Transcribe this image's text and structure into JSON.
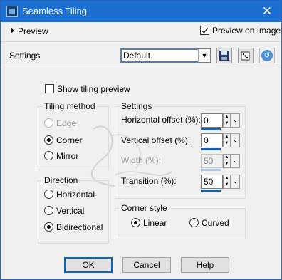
{
  "window": {
    "title": "Seamless Tiling",
    "close_glyph": "✕"
  },
  "preview": {
    "toggle_label": "Preview",
    "preview_on_image_label": "Preview on Image",
    "preview_on_image_checked": true
  },
  "settings_bar": {
    "label": "Settings",
    "preset_value": "Default",
    "icons": [
      "save-preset-icon",
      "randomize-icon",
      "reset-icon"
    ]
  },
  "show_tiling_preview": {
    "label": "Show tiling preview",
    "checked": false
  },
  "tiling_method": {
    "title": "Tiling method",
    "options": [
      {
        "label": "Edge",
        "selected": false,
        "disabled": true
      },
      {
        "label": "Corner",
        "selected": true,
        "disabled": false
      },
      {
        "label": "Mirror",
        "selected": false,
        "disabled": false
      }
    ]
  },
  "direction": {
    "title": "Direction",
    "options": [
      {
        "label": "Horizontal",
        "selected": false
      },
      {
        "label": "Vertical",
        "selected": false
      },
      {
        "label": "Bidirectional",
        "selected": true
      }
    ]
  },
  "params": {
    "title": "Settings",
    "items": [
      {
        "label": "Horizontal offset (%):",
        "value": "0",
        "disabled": false
      },
      {
        "label": "Vertical offset (%):",
        "value": "0",
        "disabled": false
      },
      {
        "label": "Width (%):",
        "value": "50",
        "disabled": true
      },
      {
        "label": "Transition (%):",
        "value": "50",
        "disabled": false
      }
    ]
  },
  "corner_style": {
    "title": "Corner style",
    "options": [
      {
        "label": "Linear",
        "selected": true
      },
      {
        "label": "Curved",
        "selected": false
      }
    ]
  },
  "buttons": {
    "ok": "OK",
    "cancel": "Cancel",
    "help": "Help"
  }
}
